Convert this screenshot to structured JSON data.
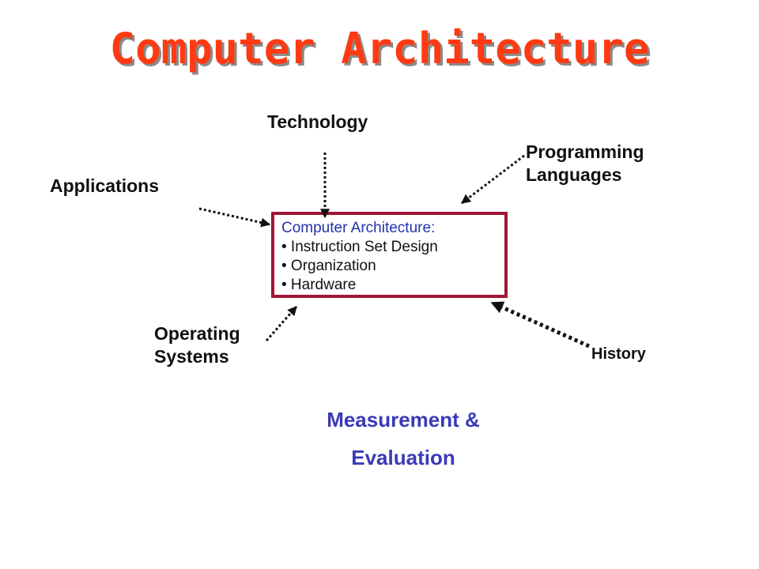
{
  "title": "Computer Architecture",
  "influences": {
    "technology": "Technology",
    "programming_languages": [
      "Programming",
      "Languages"
    ],
    "applications": "Applications",
    "operating_systems": [
      "Operating",
      "Systems"
    ],
    "history": "History"
  },
  "center_box": {
    "heading": "Computer Architecture:",
    "items": [
      "• Instruction Set  Design",
      "• Organization",
      "• Hardware"
    ]
  },
  "measurement": [
    "Measurement &",
    "Evaluation"
  ],
  "colors": {
    "title": "#ff3a12",
    "box_border": "#a01535",
    "box_heading": "#2233aa",
    "measurement": "#3a3ab8"
  }
}
